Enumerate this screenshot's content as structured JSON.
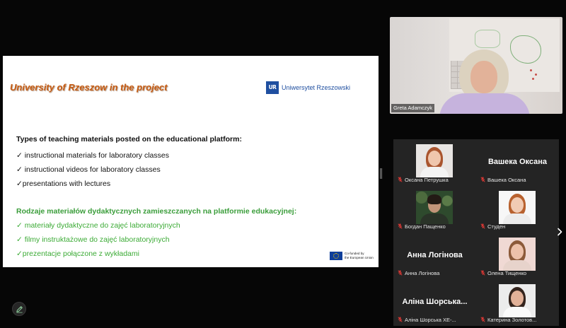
{
  "shared_screen": {
    "title": "University of Rzeszow in the project",
    "logo": {
      "mark": "UR",
      "text": "Uniwersytet Rzeszowski"
    },
    "section_en": {
      "heading": "Types of teaching materials posted on the educational platform:",
      "items": [
        "✓ instructional materials for laboratory classes",
        "✓ instructional videos for laboratory classes",
        "✓presentations with lectures"
      ]
    },
    "section_pl": {
      "heading": "Rodzaje materiałów dydaktycznych zamieszczanych na platformie edukacyjnej:",
      "items": [
        "✓ materiały dydaktyczne do zajęć laboratoryjnych",
        "✓ filmy instruktażowe do zajęć laboratoryjnych",
        "✓prezentacje połączone z wykładami"
      ]
    },
    "eu_badge": {
      "line1": "Co-funded by",
      "line2": "the European Union"
    }
  },
  "active_speaker": {
    "name": "Greta Adamczyk",
    "video_on": true
  },
  "gallery": {
    "participants": [
      {
        "label": "Оксана Петрушка",
        "video_on": true,
        "muted": true
      },
      {
        "label": "Вашека Оксана",
        "placeholder": "Вашека Оксана",
        "video_on": false,
        "muted": true
      },
      {
        "label": "Богдан Пащенко",
        "video_on": true,
        "muted": true
      },
      {
        "label": "Студен",
        "video_on": true,
        "muted": true
      },
      {
        "label": "Анна Логінова",
        "placeholder": "Анна Логінова",
        "video_on": false,
        "muted": true
      },
      {
        "label": "Олена Тищенко",
        "video_on": true,
        "muted": true
      },
      {
        "label": "Аліна Шорська ХЕ-...",
        "placeholder": "Аліна Шорська...",
        "video_on": false,
        "muted": true
      },
      {
        "label": "Катерина Золотов...",
        "video_on": true,
        "muted": true
      }
    ]
  },
  "icons": {
    "muted_mic": "muted-mic-icon",
    "next_page": "chevron-right-icon",
    "annotate": "pencil-icon",
    "resize_handle": "drag-handle-icon",
    "eu_flag": "eu-flag-icon"
  },
  "colors": {
    "title": "#c55a11",
    "logo_blue": "#1f4fa0",
    "green_heading": "#3a9d3a",
    "green_text": "#3cab36",
    "muted_mic": "#e53935",
    "panel_bg": "#242424"
  }
}
